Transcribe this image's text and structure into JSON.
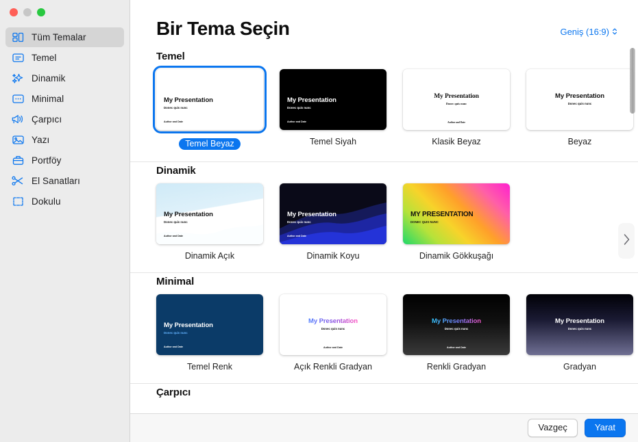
{
  "window": {
    "traffic_lights": [
      "close",
      "minimize",
      "maximize"
    ]
  },
  "sidebar": {
    "items": [
      {
        "label": "Tüm Temalar",
        "icon": "grid-squares-icon",
        "selected": true
      },
      {
        "label": "Temel",
        "icon": "text-box-icon",
        "selected": false
      },
      {
        "label": "Dinamik",
        "icon": "sparkles-icon",
        "selected": false
      },
      {
        "label": "Minimal",
        "icon": "dots-box-icon",
        "selected": false
      },
      {
        "label": "Çarpıcı",
        "icon": "megaphone-icon",
        "selected": false
      },
      {
        "label": "Yazı",
        "icon": "photo-icon",
        "selected": false
      },
      {
        "label": "Portföy",
        "icon": "briefcase-icon",
        "selected": false
      },
      {
        "label": "El Sanatları",
        "icon": "scissors-icon",
        "selected": false
      },
      {
        "label": "Dokulu",
        "icon": "crop-frame-icon",
        "selected": false
      }
    ]
  },
  "header": {
    "title": "Bir Tema Seçin",
    "aspect_ratio_label": "Geniş (16:9)",
    "aspect_ratio_icon": "chevron-up-down-icon"
  },
  "slide_text": {
    "title": "My Presentation",
    "title_upper": "MY PRESENTATION",
    "subtitle": "Donec quis nunc",
    "subtitle_upper": "DONEC QUIS NUNC",
    "footer": "Author and Date"
  },
  "sections": [
    {
      "title": "Temel",
      "themes": [
        {
          "name": "Temel Beyaz",
          "selected": true
        },
        {
          "name": "Temel Siyah",
          "selected": false
        },
        {
          "name": "Klasik Beyaz",
          "selected": false
        },
        {
          "name": "Beyaz",
          "selected": false
        }
      ]
    },
    {
      "title": "Dinamik",
      "themes": [
        {
          "name": "Dinamik Açık",
          "selected": false
        },
        {
          "name": "Dinamik Koyu",
          "selected": false
        },
        {
          "name": "Dinamik Gökkuşağı",
          "selected": false
        }
      ]
    },
    {
      "title": "Minimal",
      "themes": [
        {
          "name": "Temel Renk",
          "selected": false
        },
        {
          "name": "Açık Renkli Gradyan",
          "selected": false
        },
        {
          "name": "Renkli Gradyan",
          "selected": false
        },
        {
          "name": "Gradyan",
          "selected": false
        }
      ]
    },
    {
      "title": "Çarpıcı",
      "themes": []
    }
  ],
  "nav": {
    "next_icon": "chevron-right-icon"
  },
  "footer": {
    "cancel_label": "Vazgeç",
    "create_label": "Yarat"
  },
  "colors": {
    "accent": "#0b76ef",
    "sidebar_bg": "#ececec",
    "selected_row": "#d5d5d5",
    "navy": "#0b3b68"
  }
}
